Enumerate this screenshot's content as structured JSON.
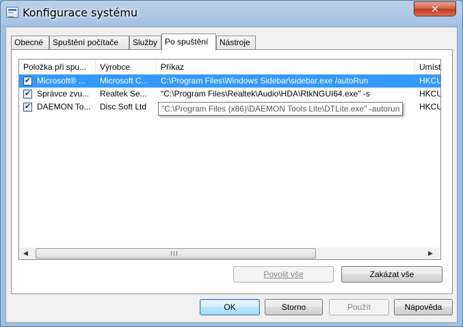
{
  "window": {
    "title": "Konfigurace systému",
    "close_symbol": "✕"
  },
  "tabs": [
    {
      "label": "Obecné"
    },
    {
      "label": "Spuštění počítače"
    },
    {
      "label": "Služby"
    },
    {
      "label": "Po spuštění",
      "active": true
    },
    {
      "label": "Nástroje"
    }
  ],
  "table": {
    "columns": [
      "Položka při spu...",
      "Výrobce",
      "Příkaz",
      "Umíst"
    ],
    "rows": [
      {
        "checked": true,
        "selected": true,
        "item": "Microsoft® ...",
        "vendor": "Microsoft C...",
        "command": "C:\\Program Files\\Windows Sidebar\\sidebar.exe /autoRun",
        "location": "HKCU"
      },
      {
        "checked": true,
        "selected": false,
        "item": "Správce zvu...",
        "vendor": "Realtek Se...",
        "command": "\"C:\\Program Files\\Realtek\\Audio\\HDA\\RtkNGUI64.exe\" -s",
        "location": "HKCU"
      },
      {
        "checked": true,
        "selected": false,
        "item": "DAEMON To...",
        "vendor": "Disc Soft Ltd",
        "command": "",
        "location": "HKCU"
      }
    ],
    "tooltip": "\"C:\\Program Files (x86)\\DAEMON Tools Lite\\DTLite.exe\" -autorun"
  },
  "scrollbar": {
    "left_arrow": "◀",
    "right_arrow": "▶"
  },
  "panel_buttons": {
    "enable_all": "Povolit vše",
    "disable_all": "Zakázat vše"
  },
  "dialog_buttons": {
    "ok": "OK",
    "cancel": "Storno",
    "apply": "Použít",
    "help": "Nápověda"
  },
  "check_glyph": "✔"
}
